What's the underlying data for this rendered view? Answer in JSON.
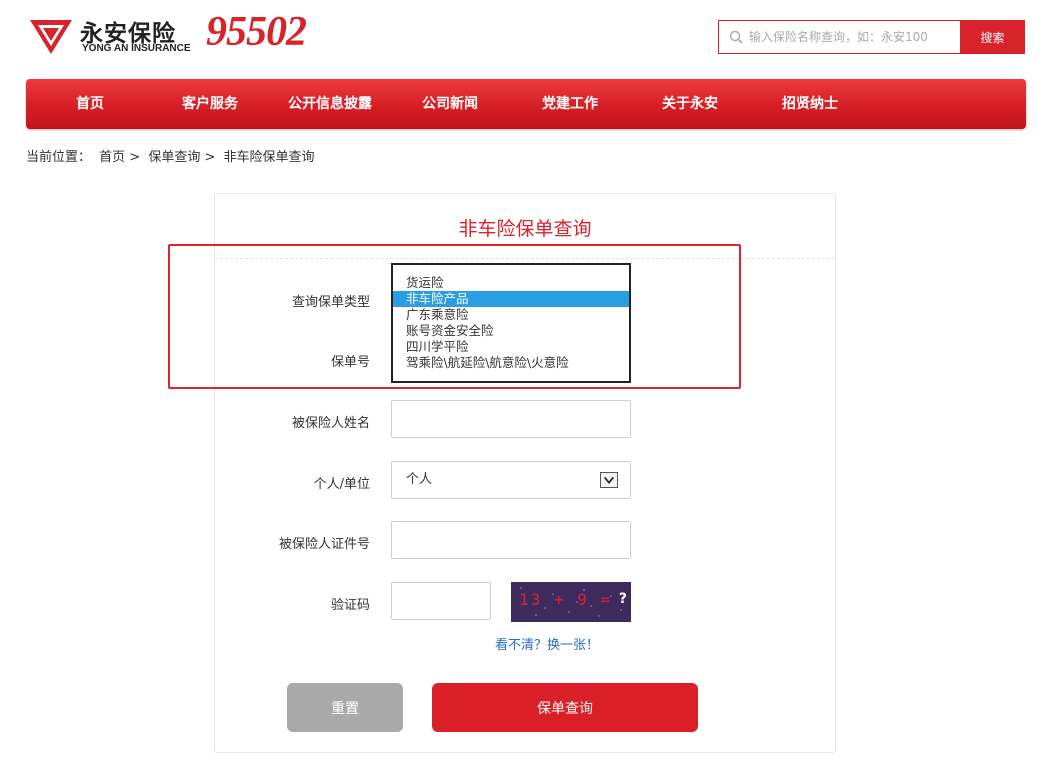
{
  "brand": {
    "name_cn": "永安保险",
    "name_en": "YONG AN INSURANCE",
    "hotline": "95502",
    "accent_color": "#d9232a"
  },
  "search": {
    "placeholder": "输入保险名称查询，如：永安100",
    "button_label": "搜索"
  },
  "nav": {
    "items": [
      "首页",
      "客户服务",
      "公开信息披露",
      "公司新闻",
      "党建工作",
      "关于永安",
      "招贤纳士"
    ]
  },
  "breadcrumb": {
    "prefix": "当前位置：",
    "items": [
      "首页 >",
      "保单查询 >",
      "非车险保单查询"
    ]
  },
  "form": {
    "title": "非车险保单查询",
    "policy_type_label": "查询保单类型",
    "policy_no_label": "保单号",
    "insured_name_label": "被保险人姓名",
    "person_type_label": "个人/单位",
    "person_type_value": "个人",
    "id_no_label": "被保险人证件号",
    "captcha_label": "验证码",
    "captcha_text": "13 + 9  = ",
    "captcha_question": "?",
    "refresh_link": "看不清？换一张！",
    "reset_button": "重置",
    "query_button": "保单查询"
  },
  "policy_type_dropdown": {
    "options": [
      "货运险",
      "非车险产品",
      "广东乘意险",
      "账号资金安全险",
      "四川学平险",
      "驾乘险\\航延险\\航意险\\火意险"
    ],
    "selected_index": 1
  }
}
